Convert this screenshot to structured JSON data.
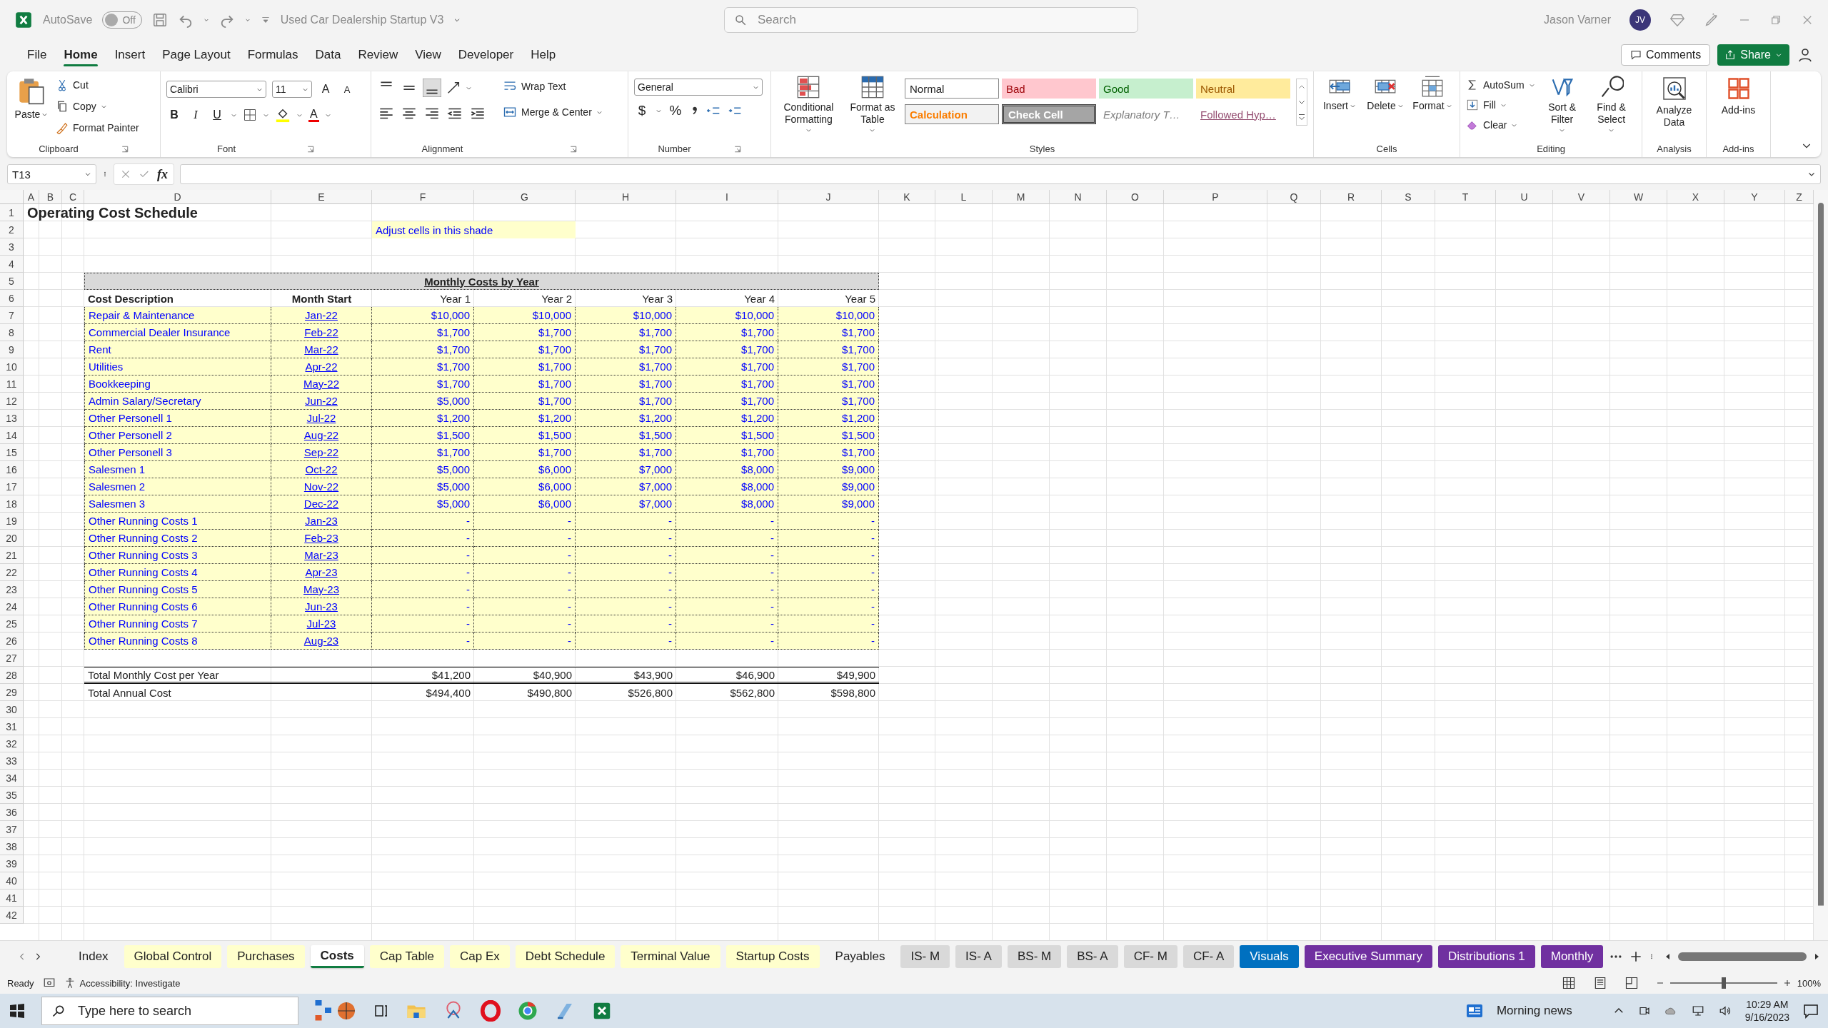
{
  "title_bar": {
    "autosave_label": "AutoSave",
    "autosave": {
      "on": false,
      "text": "Off"
    },
    "file_name": "Used Car Dealership Startup V3",
    "search_placeholder": "Search",
    "user_name": "Jason Varner",
    "avatar_initials": "JV"
  },
  "menu": {
    "tabs": [
      {
        "label": "File",
        "selected": false
      },
      {
        "label": "Home",
        "selected": true
      },
      {
        "label": "Insert",
        "selected": false
      },
      {
        "label": "Page Layout",
        "selected": false
      },
      {
        "label": "Formulas",
        "selected": false
      },
      {
        "label": "Data",
        "selected": false
      },
      {
        "label": "Review",
        "selected": false
      },
      {
        "label": "View",
        "selected": false
      },
      {
        "label": "Developer",
        "selected": false
      },
      {
        "label": "Help",
        "selected": false
      }
    ],
    "comments": "Comments",
    "share": "Share"
  },
  "ribbon": {
    "clipboard": {
      "paste": "Paste",
      "cut": "Cut",
      "copy": "Copy",
      "format_painter": "Format Painter",
      "label": "Clipboard"
    },
    "font": {
      "name": "Calibri",
      "size": "11",
      "grow": "A",
      "shrink": "A",
      "bold": "B",
      "italic": "I",
      "underline": "U",
      "font_color": "A",
      "label": "Font"
    },
    "alignment": {
      "wrap_text": "Wrap Text",
      "merge_center": "Merge & Center",
      "label": "Alignment"
    },
    "number": {
      "format": "General",
      "currency": "$",
      "percent": "%",
      "label": "Number"
    },
    "styles": {
      "conditional_formatting": "Conditional Formatting",
      "format_as_table": "Format as Table",
      "gallery": [
        {
          "label": "Normal",
          "kind": "normal"
        },
        {
          "label": "Bad",
          "kind": "bad"
        },
        {
          "label": "Good",
          "kind": "good"
        },
        {
          "label": "Neutral",
          "kind": "neutral"
        },
        {
          "label": "Calculation",
          "kind": "calculation"
        },
        {
          "label": "Check Cell",
          "kind": "check"
        },
        {
          "label": "Explanatory T…",
          "kind": "explanatory"
        },
        {
          "label": "Followed Hyp…",
          "kind": "followed"
        }
      ],
      "label": "Styles"
    },
    "cells": {
      "insert": "Insert",
      "delete": "Delete",
      "format": "Format",
      "label": "Cells"
    },
    "editing": {
      "autosum": "AutoSum",
      "fill": "Fill",
      "clear": "Clear",
      "sort_filter": "Sort & Filter",
      "find_select": "Find & Select",
      "label": "Editing"
    },
    "analysis": {
      "analyze_data": "Analyze Data",
      "label": "Analysis"
    },
    "addins": {
      "addins": "Add-ins",
      "label": "Add-ins"
    }
  },
  "formula_bar": {
    "name_box": "T13",
    "fx": "fx"
  },
  "sheet": {
    "columns": [
      "A",
      "B",
      "C",
      "D",
      "E",
      "F",
      "G",
      "H",
      "I",
      "J",
      "K",
      "L",
      "M",
      "N",
      "O",
      "P",
      "Q",
      "R",
      "S",
      "T",
      "U",
      "V",
      "W",
      "X",
      "Y",
      "Z"
    ],
    "row_numbers": [
      "1",
      "2",
      "3",
      "4",
      "5",
      "6",
      "7",
      "8",
      "9",
      "10",
      "11",
      "12",
      "13",
      "14",
      "15",
      "16",
      "17",
      "18",
      "19",
      "20",
      "21",
      "22",
      "23",
      "24",
      "25",
      "26",
      "27",
      "28",
      "29",
      "30",
      "31",
      "32",
      "33",
      "34",
      "35",
      "36",
      "37",
      "38",
      "39",
      "40",
      "41",
      "42"
    ],
    "title": "Operating Cost Schedule",
    "note": "Adjust cells in this shade",
    "table": {
      "header": "Monthly Costs by Year",
      "columns": [
        "Cost Description",
        "Month Start",
        "Year 1",
        "Year 2",
        "Year 3",
        "Year 4",
        "Year 5"
      ],
      "rows": [
        {
          "description": "Repair & Maintenance",
          "month": "Jan-22",
          "values": [
            "$10,000",
            "$10,000",
            "$10,000",
            "$10,000",
            "$10,000"
          ]
        },
        {
          "description": "Commercial Dealer Insurance",
          "month": "Feb-22",
          "values": [
            "$1,700",
            "$1,700",
            "$1,700",
            "$1,700",
            "$1,700"
          ]
        },
        {
          "description": "Rent",
          "month": "Mar-22",
          "values": [
            "$1,700",
            "$1,700",
            "$1,700",
            "$1,700",
            "$1,700"
          ]
        },
        {
          "description": "Utilities",
          "month": "Apr-22",
          "values": [
            "$1,700",
            "$1,700",
            "$1,700",
            "$1,700",
            "$1,700"
          ]
        },
        {
          "description": "Bookkeeping",
          "month": "May-22",
          "values": [
            "$1,700",
            "$1,700",
            "$1,700",
            "$1,700",
            "$1,700"
          ]
        },
        {
          "description": "Admin Salary/Secretary",
          "month": "Jun-22",
          "values": [
            "$5,000",
            "$1,700",
            "$1,700",
            "$1,700",
            "$1,700"
          ]
        },
        {
          "description": "Other Personell 1",
          "month": "Jul-22",
          "values": [
            "$1,200",
            "$1,200",
            "$1,200",
            "$1,200",
            "$1,200"
          ]
        },
        {
          "description": "Other Personell 2",
          "month": "Aug-22",
          "values": [
            "$1,500",
            "$1,500",
            "$1,500",
            "$1,500",
            "$1,500"
          ]
        },
        {
          "description": "Other Personell 3",
          "month": "Sep-22",
          "values": [
            "$1,700",
            "$1,700",
            "$1,700",
            "$1,700",
            "$1,700"
          ]
        },
        {
          "description": "Salesmen 1",
          "month": "Oct-22",
          "values": [
            "$5,000",
            "$6,000",
            "$7,000",
            "$8,000",
            "$9,000"
          ]
        },
        {
          "description": "Salesmen 2",
          "month": "Nov-22",
          "values": [
            "$5,000",
            "$6,000",
            "$7,000",
            "$8,000",
            "$9,000"
          ]
        },
        {
          "description": "Salesmen 3",
          "month": "Dec-22",
          "values": [
            "$5,000",
            "$6,000",
            "$7,000",
            "$8,000",
            "$9,000"
          ]
        },
        {
          "description": "Other Running Costs 1",
          "month": "Jan-23",
          "values": [
            "-",
            "-",
            "-",
            "-",
            "-"
          ]
        },
        {
          "description": "Other Running Costs 2",
          "month": "Feb-23",
          "values": [
            "-",
            "-",
            "-",
            "-",
            "-"
          ]
        },
        {
          "description": "Other Running Costs 3",
          "month": "Mar-23",
          "values": [
            "-",
            "-",
            "-",
            "-",
            "-"
          ]
        },
        {
          "description": "Other Running Costs 4",
          "month": "Apr-23",
          "values": [
            "-",
            "-",
            "-",
            "-",
            "-"
          ]
        },
        {
          "description": "Other Running Costs 5",
          "month": "May-23",
          "values": [
            "-",
            "-",
            "-",
            "-",
            "-"
          ]
        },
        {
          "description": "Other Running Costs 6",
          "month": "Jun-23",
          "values": [
            "-",
            "-",
            "-",
            "-",
            "-"
          ]
        },
        {
          "description": "Other Running Costs 7",
          "month": "Jul-23",
          "values": [
            "-",
            "-",
            "-",
            "-",
            "-"
          ]
        },
        {
          "description": "Other Running Costs 8",
          "month": "Aug-23",
          "values": [
            "-",
            "-",
            "-",
            "-",
            "-"
          ]
        }
      ],
      "totals": [
        {
          "label": "Total Monthly Cost per Year",
          "values": [
            "$41,200",
            "$40,900",
            "$43,900",
            "$46,900",
            "$49,900"
          ]
        },
        {
          "label": "Total Annual Cost",
          "values": [
            "$494,400",
            "$490,800",
            "$526,800",
            "$562,800",
            "$598,800"
          ]
        }
      ]
    }
  },
  "sheet_tabs": [
    {
      "label": "Index",
      "selected": false
    },
    {
      "label": "Global Control",
      "selected": false,
      "color": "#ffffcc"
    },
    {
      "label": "Purchases",
      "selected": false,
      "color": "#ffffcc"
    },
    {
      "label": "Costs",
      "selected": true
    },
    {
      "label": "Cap Table",
      "selected": false,
      "color": "#ffffcc"
    },
    {
      "label": "Cap Ex",
      "selected": false,
      "color": "#ffffcc"
    },
    {
      "label": "Debt Schedule",
      "selected": false,
      "color": "#ffffcc"
    },
    {
      "label": "Terminal Value",
      "selected": false,
      "color": "#ffffcc"
    },
    {
      "label": "Startup Costs",
      "selected": false,
      "color": "#ffffcc"
    },
    {
      "label": "Payables",
      "selected": false
    },
    {
      "label": "IS- M",
      "selected": false,
      "color": "#d9d9d9"
    },
    {
      "label": "IS- A",
      "selected": false,
      "color": "#d9d9d9"
    },
    {
      "label": "BS- M",
      "selected": false,
      "color": "#d9d9d9"
    },
    {
      "label": "BS- A",
      "selected": false,
      "color": "#d9d9d9"
    },
    {
      "label": "CF- M",
      "selected": false,
      "color": "#d9d9d9"
    },
    {
      "label": "CF- A",
      "selected": false,
      "color": "#d9d9d9"
    },
    {
      "label": "Visuals",
      "selected": false,
      "color": "#0070c0"
    },
    {
      "label": "Executive Summary",
      "selected": false,
      "color": "#7030a0"
    },
    {
      "label": "Distributions 1",
      "selected": false,
      "color": "#7030a0"
    },
    {
      "label": "Monthly",
      "selected": false,
      "color": "#7030a0"
    }
  ],
  "status_bar": {
    "ready": "Ready",
    "accessibility": "Accessibility: Investigate",
    "zoom": {
      "level": 0.5,
      "text": "100%"
    }
  },
  "taskbar": {
    "search_placeholder": "Type here to search",
    "news": "Morning news",
    "time": "10:29 AM",
    "date": "9/16/2023"
  }
}
